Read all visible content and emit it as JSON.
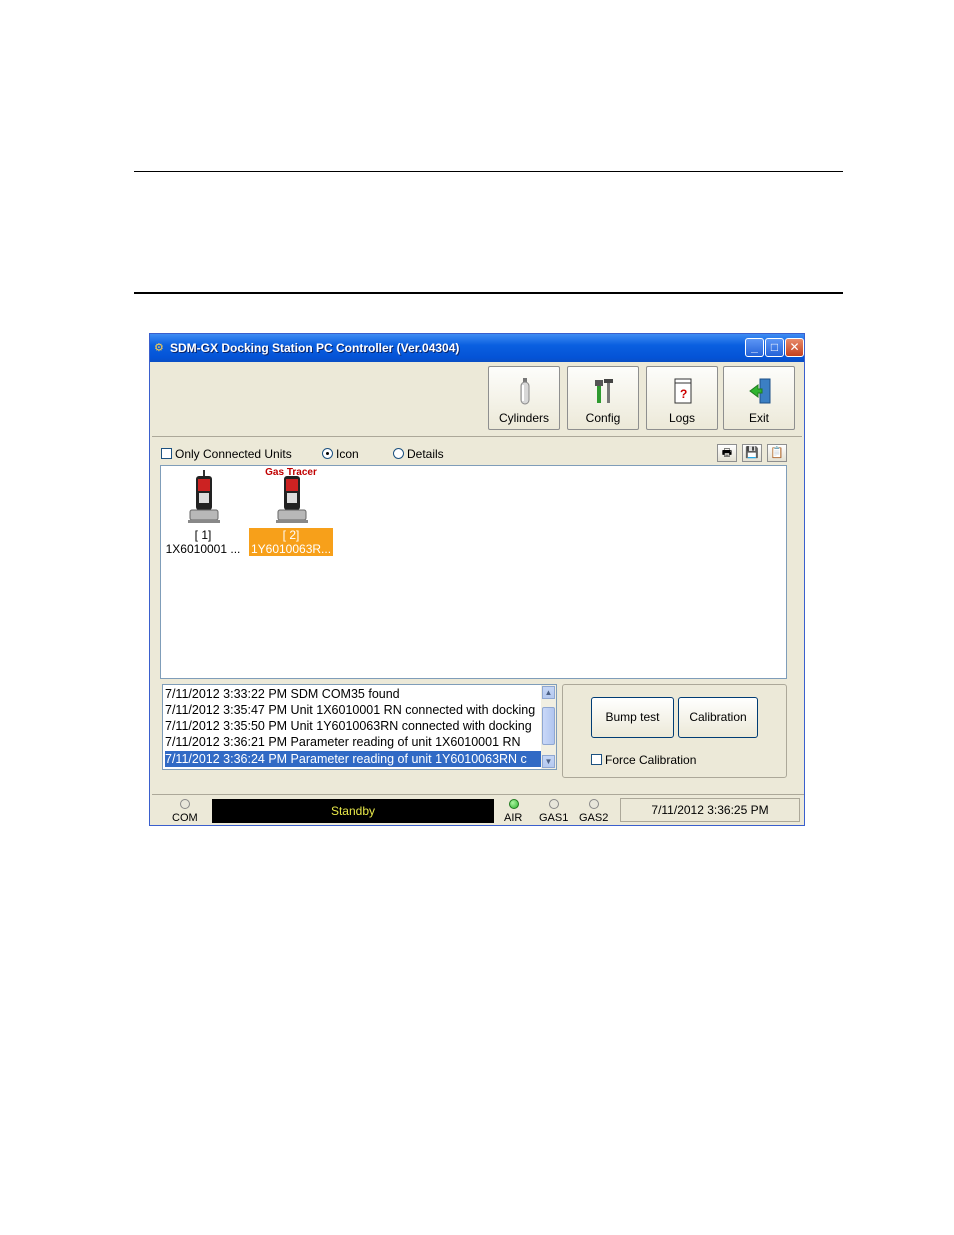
{
  "window": {
    "title": "SDM-GX Docking Station PC Controller (Ver.04304)",
    "controls": {
      "minimize": "_",
      "maximize": "□",
      "close": "✕"
    }
  },
  "toolbar": {
    "buttons": [
      {
        "label": "Cylinders",
        "icon": "cylinder-icon"
      },
      {
        "label": "Config",
        "icon": "tools-icon"
      },
      {
        "label": "Logs",
        "icon": "notebook-icon"
      },
      {
        "label": "Exit",
        "icon": "exit-door-icon"
      }
    ]
  },
  "options": {
    "only_connected": {
      "label": "Only Connected Units",
      "checked": false
    },
    "view_icon": {
      "label": "Icon",
      "selected": true
    },
    "view_details": {
      "label": "Details",
      "selected": false
    },
    "small_buttons": [
      "printer-icon",
      "save-icon",
      "clipboard-icon"
    ]
  },
  "units": [
    {
      "slot": "[ 1]",
      "serial": "1X6010001 ...",
      "tag": "",
      "selected": false
    },
    {
      "slot": "[ 2]",
      "serial": "1Y6010063R...",
      "tag": "Gas Tracer",
      "selected": true
    }
  ],
  "log": [
    "7/11/2012 3:33:22 PM SDM COM35 found",
    "7/11/2012 3:35:47 PM Unit 1X6010001 RN connected with docking",
    "7/11/2012 3:35:50 PM Unit 1Y6010063RN connected with docking",
    "7/11/2012 3:36:21 PM Parameter reading of unit 1X6010001 RN",
    "7/11/2012 3:36:24 PM Parameter reading of unit 1Y6010063RN c"
  ],
  "actions": {
    "bump_test": "Bump test",
    "calibration": "Calibration",
    "force_calibration": "Force Calibration"
  },
  "status": {
    "com": "COM",
    "state": "Standby",
    "air": "AIR",
    "gas1": "GAS1",
    "gas2": "GAS2",
    "datetime": "7/11/2012 3:36:25 PM",
    "air_on": true
  }
}
